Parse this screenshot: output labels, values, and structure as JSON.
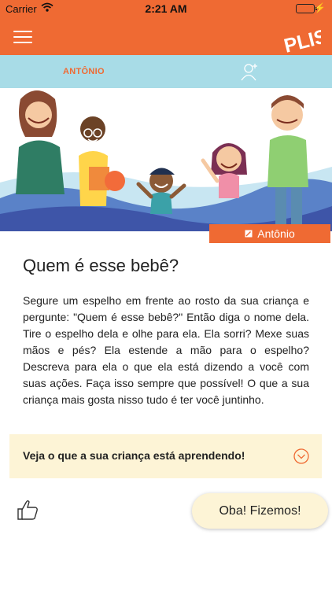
{
  "status_bar": {
    "carrier": "Carrier",
    "time": "2:21 AM"
  },
  "header": {
    "logo_text": "PLIS!",
    "menu_icon": "hamburger-icon"
  },
  "profile_bar": {
    "child_tab": "ANTÔNIO",
    "add_icon": "add-user-icon"
  },
  "child_badge": {
    "label": "Antônio",
    "icon": "edit-icon"
  },
  "activity": {
    "title": "Quem é esse bebê?",
    "description": "Segure um espelho em frente ao rosto da sua criança e pergunte: \"Quem é esse bebê?\" Então diga o nome dela. Tire o espelho dela e olhe para ela. Ela sorri? Mexe suas mãos e pés? Ela estende a mão para o espelho? Descreva para ela o que ela está dizendo a você com suas ações. Faça isso sempre que possível! O que a sua criança mais gosta nisso tudo é ter você juntinho."
  },
  "learning_panel": {
    "label": "Veja o que a sua criança está aprendendo!",
    "icon": "chevron-down-icon"
  },
  "actions": {
    "like_icon": "thumbs-up-icon",
    "done_label": "Oba! Fizemos!"
  },
  "colors": {
    "brand_orange": "#ef6a33",
    "light_blue": "#a8dce7",
    "cream": "#fdf4d6"
  }
}
